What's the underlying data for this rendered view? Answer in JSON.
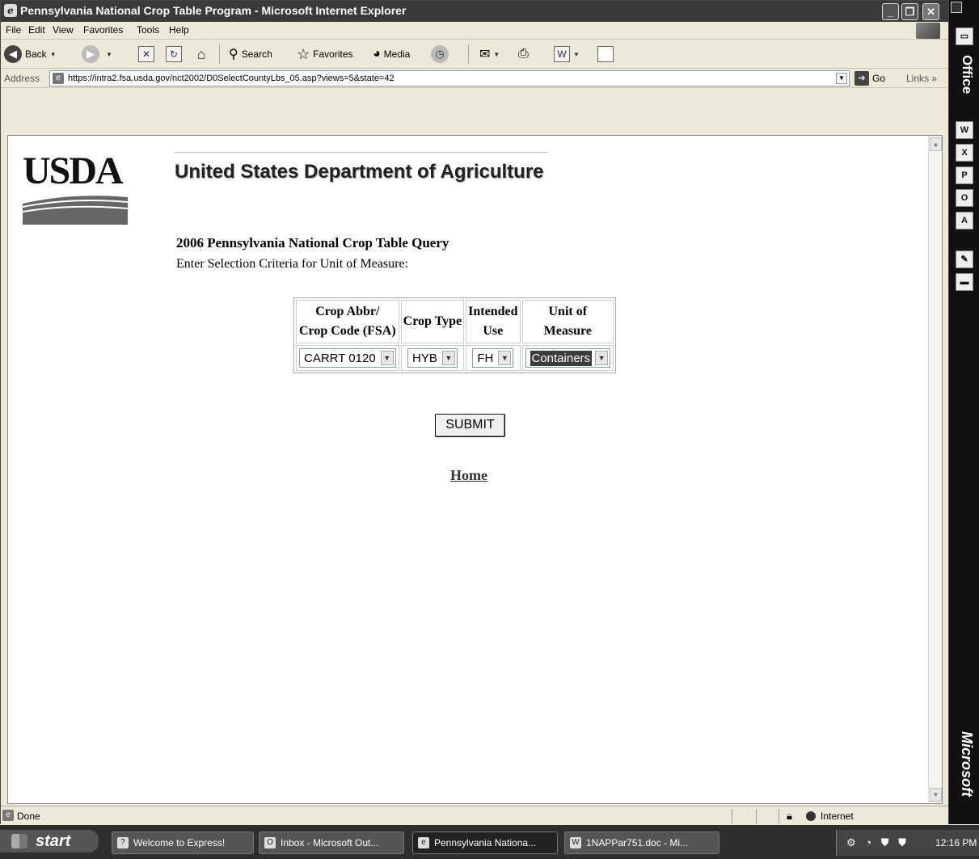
{
  "window": {
    "title": "Pennsylvania National Crop Table Program - Microsoft Internet Explorer",
    "minimize_glyph": "_",
    "maximize_glyph": "❐",
    "close_glyph": "✕"
  },
  "menu": [
    "File",
    "Edit",
    "View",
    "Favorites",
    "Tools",
    "Help"
  ],
  "toolbar": {
    "back_label": "Back",
    "search_label": "Search",
    "favorites_label": "Favorites",
    "media_label": "Media"
  },
  "address": {
    "label": "Address",
    "url": "https://intra2.fsa.usda.gov/nct2002/D0SelectCountyLbs_05.asp?views=5&state=42",
    "go_label": "Go",
    "links_label": "Links"
  },
  "page": {
    "logo_text": "USDA",
    "dept_title": "United States Department of Agriculture",
    "query_title": "2006 Pennsylvania National Crop Table Query",
    "instructions": "Enter Selection Criteria for Unit of Measure:",
    "table": {
      "headers": {
        "crop": [
          "Crop Abbr/",
          "Crop Code (FSA)"
        ],
        "type": [
          "Crop Type"
        ],
        "use": [
          "Intended",
          "Use"
        ],
        "unit": [
          "Unit of",
          "Measure"
        ]
      },
      "values": {
        "crop": "CARRT 0120",
        "type": "HYB",
        "use": "FH",
        "unit": "Containers"
      }
    },
    "submit_label": "SUBMIT",
    "home_link": "Home"
  },
  "status": {
    "text": "Done",
    "zone": "Internet"
  },
  "office_bar": {
    "top_label": "Office",
    "bottom_label": "Microsoft"
  },
  "taskbar": {
    "start_label": "start",
    "tasks": [
      "Welcome to Express!",
      "Inbox - Microsoft Out...",
      "Pennsylvania Nationa...",
      "1NAPPar751.doc - Mi..."
    ],
    "clock": "12:16 PM"
  }
}
